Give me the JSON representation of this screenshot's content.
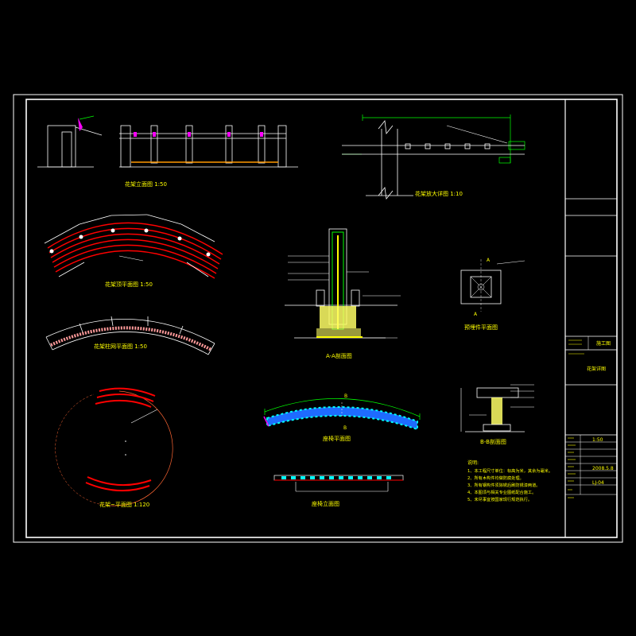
{
  "colors": {
    "background": "#000000",
    "frame": "#ffffff",
    "label": "#ffff00",
    "cyan": "#00ffff",
    "red": "#ff0000",
    "green": "#00ff00",
    "magenta": "#ff00ff",
    "blue": "#1e6bff",
    "orange": "#ff9900",
    "pink": "#ff9a9a"
  },
  "views": {
    "pergola_elevation": "花架立面图 1:50",
    "detail_enlarged": "花架放大详图 1:10",
    "top_plan": "花架顶平面图 1:50",
    "column_plan": "花架柱网平面图 1:50",
    "position_plan": "花架~平面图 1:120",
    "section_aa": "A-A剖面图",
    "anchor_plan": "预埋件平面图",
    "seat_plan": "座椅平面图",
    "section_bb": "B-B剖面图",
    "seat_elevation": "座椅立面图"
  },
  "section_markers": {
    "a": "A",
    "b": "B"
  },
  "notes": {
    "title": "说明:",
    "items": [
      "1、本工程尺寸单位：标高为米，其余为毫米。",
      "2、所有木构件均做防腐处理。",
      "3、所有钢构件须除锈后刷防锈漆两道。",
      "4、本图须与相关专业图纸配合施工。",
      "5、未尽事宜按国家现行规范执行。"
    ]
  },
  "title_block": {
    "stage": "施工图",
    "drawing_name": "花架详图",
    "scale": "1:50",
    "date": "2008.5.8",
    "number": "LJ-04"
  }
}
